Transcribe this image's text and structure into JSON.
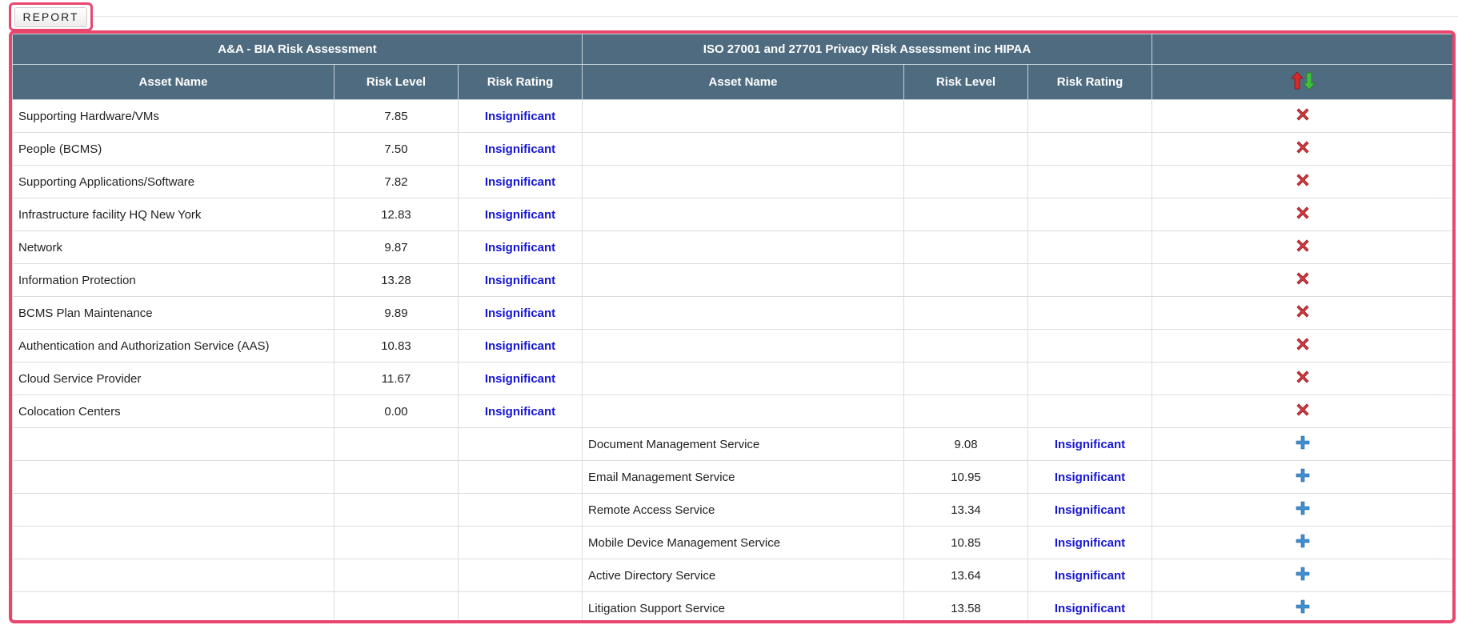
{
  "report_button": {
    "label": "REPORT"
  },
  "table": {
    "groups": {
      "left": "A&A - BIA Risk Assessment",
      "right": "ISO 27001 and 27701 Privacy Risk Assessment inc HIPAA"
    },
    "columns": {
      "asset_name": "Asset Name",
      "risk_level": "Risk Level",
      "risk_rating": "Risk Rating",
      "sort_icon": "sort-up-down-icon"
    },
    "left_rows": [
      {
        "asset": "Supporting Hardware/VMs",
        "level": "7.85",
        "rating": "Insignificant"
      },
      {
        "asset": "People (BCMS)",
        "level": "7.50",
        "rating": "Insignificant"
      },
      {
        "asset": "Supporting Applications/Software",
        "level": "7.82",
        "rating": "Insignificant"
      },
      {
        "asset": "Infrastructure facility HQ New York",
        "level": "12.83",
        "rating": "Insignificant"
      },
      {
        "asset": "Network",
        "level": "9.87",
        "rating": "Insignificant"
      },
      {
        "asset": "Information Protection",
        "level": "13.28",
        "rating": "Insignificant"
      },
      {
        "asset": "BCMS Plan Maintenance",
        "level": "9.89",
        "rating": "Insignificant"
      },
      {
        "asset": "Authentication and Authorization Service (AAS)",
        "level": "10.83",
        "rating": "Insignificant"
      },
      {
        "asset": "Cloud Service Provider",
        "level": "11.67",
        "rating": "Insignificant"
      },
      {
        "asset": "Colocation Centers",
        "level": "0.00",
        "rating": "Insignificant"
      }
    ],
    "right_rows": [
      {
        "asset": "Document Management Service",
        "level": "9.08",
        "rating": "Insignificant"
      },
      {
        "asset": "Email Management Service",
        "level": "10.95",
        "rating": "Insignificant"
      },
      {
        "asset": "Remote Access Service",
        "level": "13.34",
        "rating": "Insignificant"
      },
      {
        "asset": "Mobile Device Management Service",
        "level": "10.85",
        "rating": "Insignificant"
      },
      {
        "asset": "Active Directory Service",
        "level": "13.64",
        "rating": "Insignificant"
      },
      {
        "asset": "Litigation Support Service",
        "level": "13.58",
        "rating": "Insignificant"
      }
    ],
    "left_row_icon": "delete-x-icon",
    "right_row_icon": "add-plus-icon"
  },
  "colors": {
    "header_bg": "#4f6b80",
    "highlight_border": "#e8466d",
    "rating_text": "#1515d4",
    "delete_icon": "#d6393f",
    "add_icon": "#3f8fd2"
  }
}
